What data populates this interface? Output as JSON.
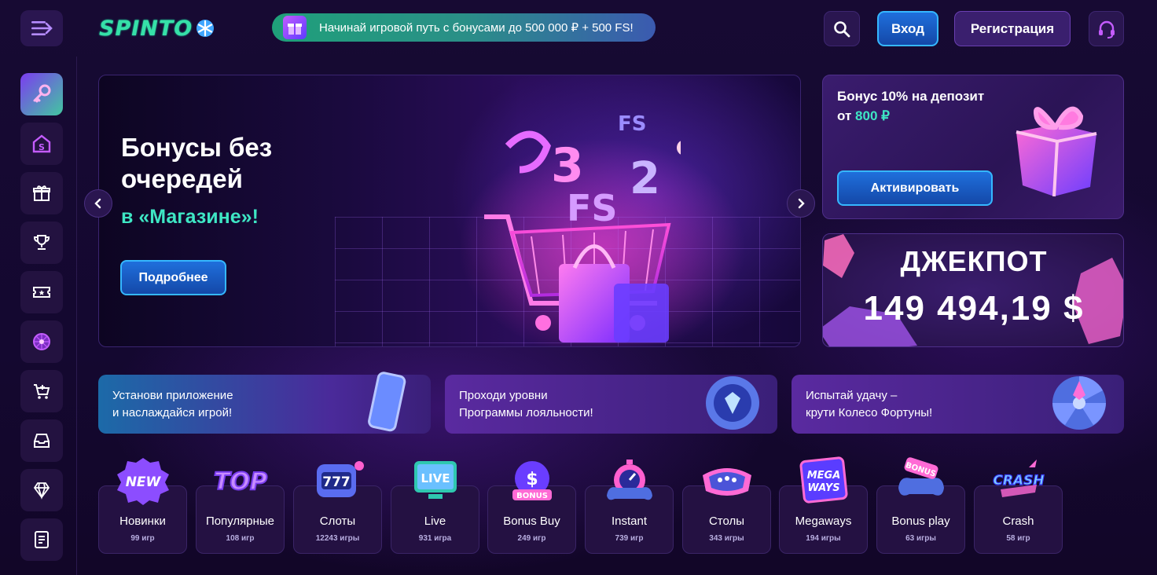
{
  "header": {
    "logo_text": "SPINTO",
    "promo_text": "Начинай игровой путь с бонусами до 500 000 ₽ + 500 FS!",
    "login_label": "Вход",
    "register_label": "Регистрация"
  },
  "hero": {
    "title": "Бонусы без очередей",
    "subtitle": "в «Магазине»!",
    "button_label": "Подробнее"
  },
  "bonus_card": {
    "line1": "Бонус 10% на депозит",
    "line2_prefix": "от",
    "amount": "800 ₽",
    "button_label": "Активировать"
  },
  "jackpot": {
    "title": "ДЖЕКПОТ",
    "value": "149 494,19 $"
  },
  "strips": [
    {
      "line1": "Установи приложение",
      "line2": "и наслаждайся игрой!"
    },
    {
      "line1": "Проходи уровни",
      "line2": "Программы лояльности!"
    },
    {
      "line1": "Испытай удачу –",
      "line2": "крути Колесо Фортуны!"
    }
  ],
  "categories": [
    {
      "name": "Новинки",
      "count": "99 игр",
      "badge": "NEW"
    },
    {
      "name": "Популярные",
      "count": "108 игр",
      "badge": "TOP"
    },
    {
      "name": "Слоты",
      "count": "12243 игры",
      "badge": "777"
    },
    {
      "name": "Live",
      "count": "931 игра",
      "badge": "LIVE"
    },
    {
      "name": "Bonus Buy",
      "count": "249 игр",
      "badge": "BONUS"
    },
    {
      "name": "Instant",
      "count": "739 игр",
      "badge": ""
    },
    {
      "name": "Столы",
      "count": "343 игры",
      "badge": ""
    },
    {
      "name": "Megaways",
      "count": "194 игры",
      "badge": "MEGA WAYS"
    },
    {
      "name": "Bonus play",
      "count": "63 игры",
      "badge": "BONUS"
    },
    {
      "name": "Crash",
      "count": "58 игр",
      "badge": "CRASH"
    }
  ],
  "colors": {
    "accent": "#3ee6c4",
    "primary_button": "#1f6fdc",
    "background": "#12072a"
  },
  "sidebar_icons": [
    "key-icon",
    "spinto-s-icon",
    "gift-icon",
    "trophy-icon",
    "ticket-icon",
    "wheel-icon",
    "cart-icon",
    "inbox-icon",
    "diamond-icon",
    "document-icon"
  ]
}
